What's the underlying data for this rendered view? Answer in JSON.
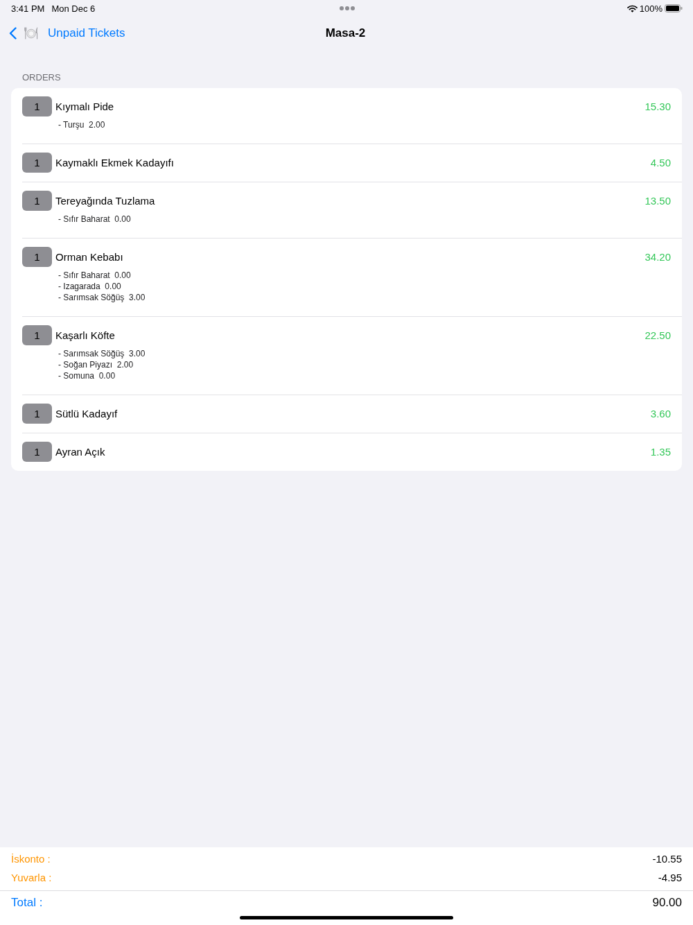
{
  "status_bar": {
    "time": "3:41 PM",
    "date": "Mon Dec 6",
    "battery": "100%"
  },
  "nav_bar": {
    "back_label": "Unpaid Tickets",
    "title": "Masa-2"
  },
  "orders": {
    "header": "ORDERS",
    "items": [
      {
        "quantity": "1",
        "name": "Kıymalı Pide",
        "price": "15.30",
        "modifiers": [
          "- Turşu  2.00"
        ]
      },
      {
        "quantity": "1",
        "name": "Kaymaklı Ekmek Kadayıfı",
        "price": "4.50"
      },
      {
        "quantity": "1",
        "name": "Tereyağında Tuzlama",
        "price": "13.50",
        "modifiers": [
          "- Sıfır Baharat  0.00"
        ]
      },
      {
        "quantity": "1",
        "name": "Orman Kebabı",
        "price": "34.20",
        "modifiers": [
          "- Sıfır Baharat  0.00",
          "- Izagarada  0.00",
          "- Sarımsak Söğüş  3.00"
        ]
      },
      {
        "quantity": "1",
        "name": "Kaşarlı Köfte",
        "price": "22.50",
        "modifiers": [
          "- Sarımsak Söğüş  3.00",
          "- Soğan Piyazı  2.00",
          "- Somuna  0.00"
        ]
      },
      {
        "quantity": "1",
        "name": "Sütlü Kadayıf",
        "price": "3.60"
      },
      {
        "quantity": "1",
        "name": "Ayran Açık",
        "price": "1.35"
      }
    ]
  },
  "summary": {
    "adjustments": [
      {
        "label": "İskonto :",
        "value": "-10.55"
      },
      {
        "label": "Yuvarla :",
        "value": "-4.95"
      }
    ],
    "total": {
      "label": "Total :",
      "value": "90.00"
    }
  }
}
